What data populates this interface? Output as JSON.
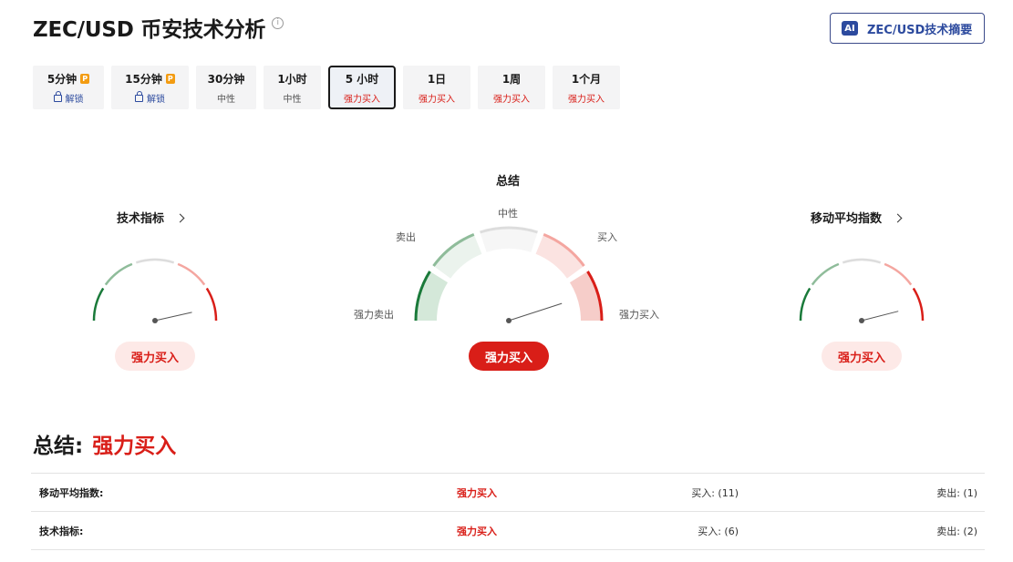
{
  "header": {
    "title": "ZEC/USD 币安技术分析",
    "info": "i"
  },
  "ai_button": {
    "badge": "AI",
    "label": "ZEC/USD技术摘要"
  },
  "tabs": [
    {
      "label": "5分钟",
      "sub": "解锁",
      "locked": true,
      "pro": "P"
    },
    {
      "label": "15分钟",
      "sub": "解锁",
      "locked": true,
      "pro": "P"
    },
    {
      "label": "30分钟",
      "sub": "中性"
    },
    {
      "label": "1小时",
      "sub": "中性"
    },
    {
      "label": "5 小时",
      "sub": "强力买入",
      "active": true
    },
    {
      "label": "1日",
      "sub": "强力买入"
    },
    {
      "label": "1周",
      "sub": "强力买入"
    },
    {
      "label": "1个月",
      "sub": "强力买入"
    }
  ],
  "gauges": {
    "technical": {
      "title": "技术指标",
      "result": "强力买入",
      "level": 0.93
    },
    "summary": {
      "title": "总结",
      "result": "强力买入",
      "level": 0.9,
      "labels": {
        "strong_sell": "强力卖出",
        "sell": "卖出",
        "neutral": "中性",
        "buy": "买入",
        "strong_buy": "强力买入"
      }
    },
    "moving_average": {
      "title": "移动平均指数",
      "result": "强力买入",
      "level": 0.92
    }
  },
  "summary": {
    "label": "总结:",
    "value": "强力买入"
  },
  "table": [
    {
      "name": "移动平均指数:",
      "signal": "强力买入",
      "buy": "买入: (11)",
      "sell": "卖出: (1)"
    },
    {
      "name": "技术指标:",
      "signal": "强力买入",
      "buy": "买入: (6)",
      "sell": "卖出: (2)"
    }
  ],
  "colors": {
    "strong_red": "#d91e18",
    "light_red": "#f4a6a0",
    "gray": "#dddddd",
    "light_green": "#8fbc9a",
    "strong_green": "#1a7a3a",
    "brand_blue": "#2c4a9e"
  }
}
